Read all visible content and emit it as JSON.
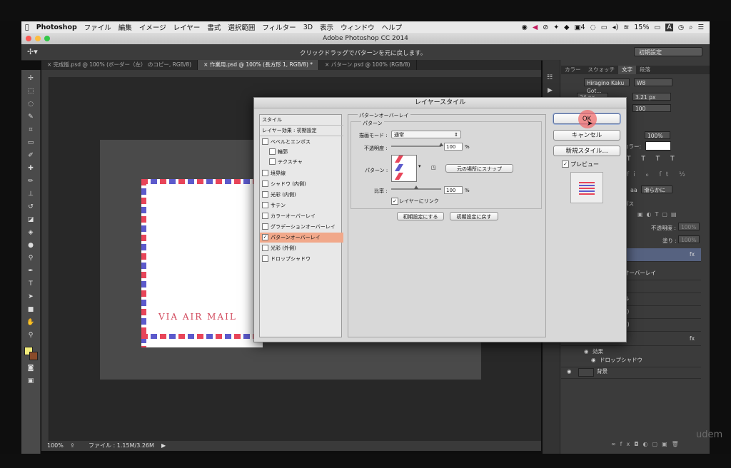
{
  "menubar": {
    "apple_icon": "apple-logo",
    "app_name": "Photoshop",
    "items": [
      "ファイル",
      "編集",
      "イメージ",
      "レイヤー",
      "書式",
      "選択範囲",
      "フィルター",
      "3D",
      "表示",
      "ウィンドウ",
      "ヘルプ"
    ],
    "right": {
      "notification": "4",
      "battery": "15%",
      "input": "A"
    }
  },
  "window": {
    "title": "Adobe Photoshop CC 2014"
  },
  "options_bar": {
    "hint": "クリックドラッグでパターンを元に戻します。",
    "preset": "初期設定"
  },
  "tabs": [
    {
      "label": "完成版.psd @ 100% (ボーダー（左） のコピー, RGB/8)"
    },
    {
      "label": "作業用.psd @ 100% (長方形 1, RGB/8) *"
    },
    {
      "label": "パターン.psd @ 100% (RGB/8)"
    }
  ],
  "canvas": {
    "envelope_text": "VIA AIR MAIL",
    "colors": {
      "red": "#e84559",
      "blue": "#5c5acc"
    }
  },
  "status": {
    "zoom": "100%",
    "file_info": "ファイル : 1.15M/3.26M"
  },
  "char_panel": {
    "tabs": [
      "カラー",
      "スウォッチ",
      "文字",
      "段落"
    ],
    "font_family": "Hiragino Kaku Got...",
    "font_weight": "W8",
    "size": "24 px",
    "leading": "3.21 px",
    "tracking": "100",
    "scale": "100%",
    "color_label": "カラー:",
    "antialias_label": "aa",
    "antialias": "滑らかに"
  },
  "layers_panel": {
    "tab": "パス",
    "opacity_label": "不透明度 :",
    "opacity": "100%",
    "fill_label": "塗り :",
    "fill": "100%",
    "rows": [
      {
        "label": "",
        "fx": "fx"
      },
      {
        "label": "オーバーレイ"
      },
      {
        "label": ""
      },
      {
        "label": "ル"
      },
      {
        "label": "F)"
      },
      {
        "label": "E)"
      },
      {
        "label": "",
        "fx": "fx"
      },
      {
        "label": "効果"
      },
      {
        "label": "ドロップシャドウ"
      },
      {
        "label": "背景"
      }
    ]
  },
  "dialog": {
    "title": "レイヤースタイル",
    "style_header": "スタイル",
    "effects_header": "レイヤー効果 : 初期設定",
    "styles": [
      {
        "label": "ベベルとエンボス",
        "checked": false
      },
      {
        "label": "輪郭",
        "checked": false,
        "sub": true
      },
      {
        "label": "テクスチャ",
        "checked": false,
        "sub": true
      },
      {
        "label": "境界線",
        "checked": false
      },
      {
        "label": "シャドウ (内側)",
        "checked": false
      },
      {
        "label": "光彩 (内側)",
        "checked": false
      },
      {
        "label": "サテン",
        "checked": false
      },
      {
        "label": "カラーオーバーレイ",
        "checked": false
      },
      {
        "label": "グラデーションオーバーレイ",
        "checked": false
      },
      {
        "label": "パターンオーバーレイ",
        "checked": true,
        "selected": true
      },
      {
        "label": "光彩 (外側)",
        "checked": false
      },
      {
        "label": "ドロップシャドウ",
        "checked": false
      }
    ],
    "panel_title": "パターンオーバーレイ",
    "section_title": "パターン",
    "blend_label": "描画モード :",
    "blend_value": "通常",
    "opacity_label": "不透明度 :",
    "opacity_value": "100",
    "opacity_pct": 100,
    "percent": "%",
    "pattern_label": "パターン :",
    "snap_button": "元の場所にスナップ",
    "scale_label": "比率 :",
    "scale_value": "100",
    "link_label": "レイヤーにリンク",
    "link_checked": true,
    "make_default": "初期設定にする",
    "reset_default": "初期設定に戻す",
    "ok": "OK",
    "cancel": "キャンセル",
    "new_style": "新規スタイル...",
    "preview_label": "プレビュー",
    "preview_checked": true
  },
  "watermark": "udem"
}
